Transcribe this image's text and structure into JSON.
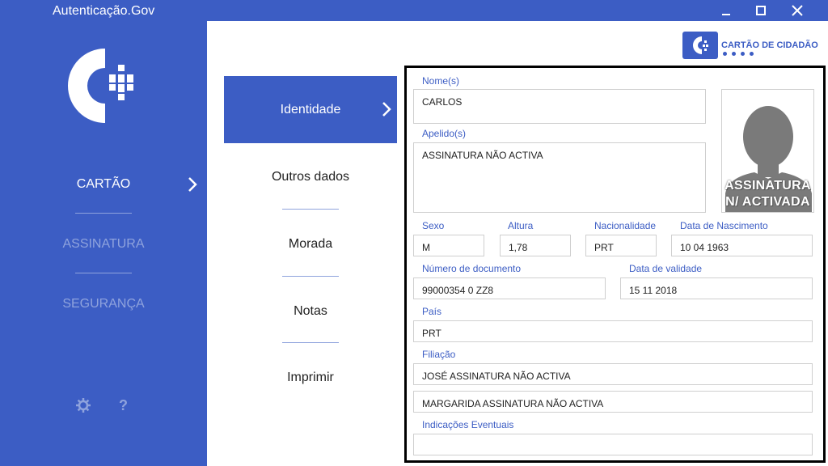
{
  "window": {
    "title": "Autenticação.Gov"
  },
  "colors": {
    "accent": "#3c5dc4",
    "muted": "#8fa3dd"
  },
  "sidebar": {
    "items": [
      {
        "label": "CARTÃO"
      },
      {
        "label": "ASSINATURA"
      },
      {
        "label": "SEGURANÇA"
      }
    ],
    "settings_icon": "gear-icon",
    "help_icon": "?"
  },
  "brand": {
    "text": "CARTÃO DE CIDADÃO"
  },
  "tabs": [
    {
      "label": "Identidade"
    },
    {
      "label": "Outros dados"
    },
    {
      "label": "Morada"
    },
    {
      "label": "Notas"
    },
    {
      "label": "Imprimir"
    }
  ],
  "photo": {
    "line1": "ASSINATURA",
    "line2": "N/ ACTIVADA"
  },
  "fields": {
    "nome": {
      "label": "Nome(s)",
      "value": "CARLOS"
    },
    "apelido": {
      "label": "Apelido(s)",
      "value": "ASSINATURA NÃO ACTIVA"
    },
    "sexo": {
      "label": "Sexo",
      "value": "M"
    },
    "altura": {
      "label": "Altura",
      "value": "1,78"
    },
    "nacionalidade": {
      "label": "Nacionalidade",
      "value": "PRT"
    },
    "nascimento": {
      "label": "Data de Nascimento",
      "value": "10 04 1963"
    },
    "documento": {
      "label": "Número de documento",
      "value": "99000354 0 ZZ8"
    },
    "validade": {
      "label": "Data de validade",
      "value": "15 11 2018"
    },
    "pais": {
      "label": "País",
      "value": "PRT"
    },
    "filiacao": {
      "label": "Filiação",
      "pai": "JOSÉ ASSINATURA NÃO ACTIVA",
      "mae": "MARGARIDA ASSINATURA NÃO ACTIVA"
    },
    "indicacoes": {
      "label": "Indicações Eventuais",
      "value": ""
    }
  }
}
